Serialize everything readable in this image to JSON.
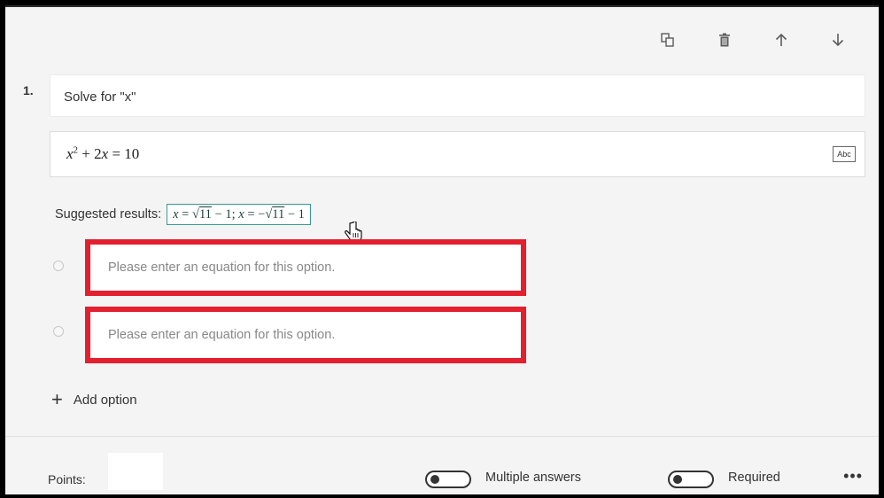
{
  "toolbar": {
    "copy_icon": "copy-icon",
    "delete_icon": "trash-icon",
    "move_up_icon": "arrow-up-icon",
    "move_down_icon": "arrow-down-icon"
  },
  "question": {
    "number": "1.",
    "title": "Solve for \"x\"",
    "equation_parts": {
      "x": "x",
      "exp": "2",
      "rest": "+ 2",
      "x2": "x",
      "eq": "= 10"
    },
    "input_mode_icon_label": "Abc"
  },
  "suggested": {
    "label": "Suggested results:",
    "r1_var": "x",
    "r1_eq": " = ",
    "r1_sqrt": "√",
    "r1_rad": "11",
    "r1_tail": " − 1; ",
    "r2_var": "x",
    "r2_eq": " = −",
    "r2_sqrt": "√",
    "r2_rad": "11",
    "r2_tail": " − 1"
  },
  "options": [
    {
      "placeholder": "Please enter an equation for this option."
    },
    {
      "placeholder": "Please enter an equation for this option."
    }
  ],
  "add_option_label": "Add option",
  "footer": {
    "points_label": "Points:",
    "points_value": "",
    "multiple_answers_label": "Multiple answers",
    "required_label": "Required",
    "more_label": "•••"
  },
  "colors": {
    "highlight_border": "#e2202f",
    "chip_border": "#3a9a8a",
    "background": "#f4f4f4"
  }
}
